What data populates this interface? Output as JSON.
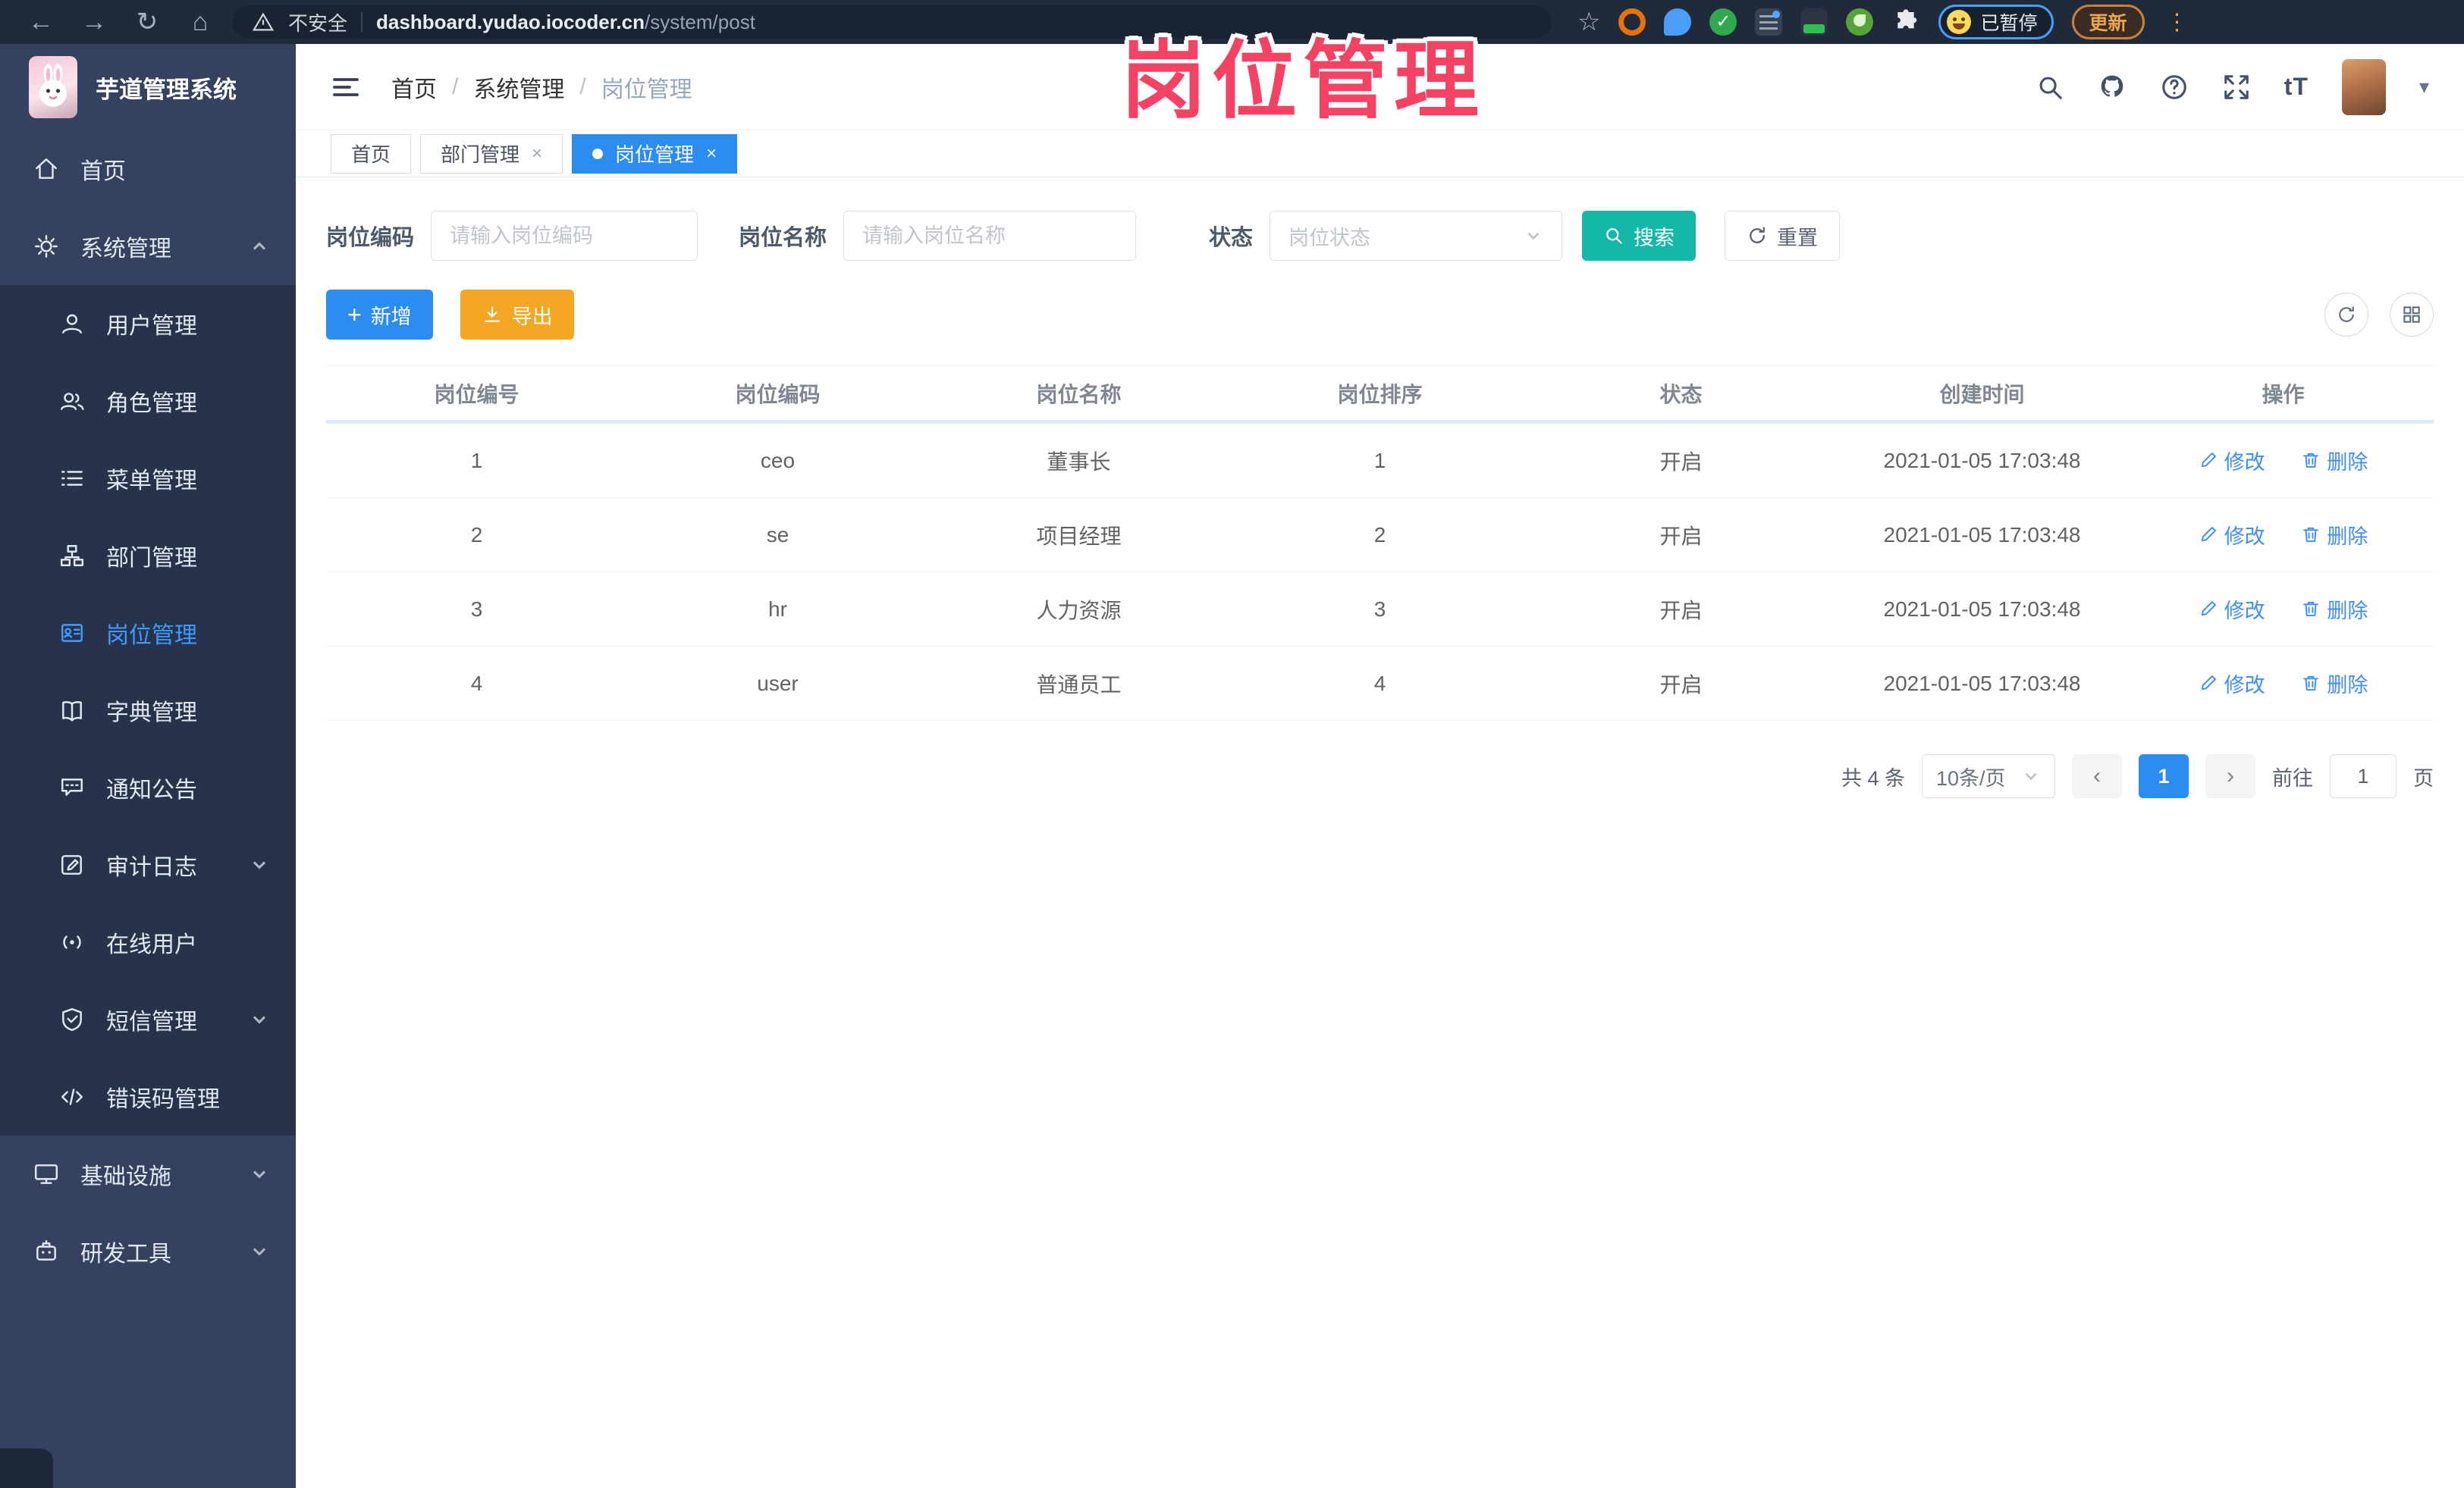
{
  "overlay": {
    "title": "岗位管理"
  },
  "browser": {
    "security_label": "不安全",
    "url_domain": "dashboard.yudao.iocoder.cn",
    "url_path": "/system/post",
    "paused_label": "已暂停",
    "update_label": "更新"
  },
  "colors": {
    "accent": "#2d8cf0",
    "teal": "#15b8a8",
    "warning": "#f5a623",
    "link": "#3e8ef7",
    "overlay_pink": "#f54263",
    "sidebar_bg": "#35425f",
    "submenu_bg": "#27334a"
  },
  "sidebar": {
    "logo_title": "芋道管理系统",
    "home_label": "首页",
    "system_label": "系统管理",
    "infra_label": "基础设施",
    "devtools_label": "研发工具",
    "submenu": [
      {
        "label": "用户管理"
      },
      {
        "label": "角色管理"
      },
      {
        "label": "菜单管理"
      },
      {
        "label": "部门管理"
      },
      {
        "label": "岗位管理"
      },
      {
        "label": "字典管理"
      },
      {
        "label": "通知公告"
      },
      {
        "label": "审计日志"
      },
      {
        "label": "在线用户"
      },
      {
        "label": "短信管理"
      },
      {
        "label": "错误码管理"
      }
    ]
  },
  "header": {
    "breadcrumb": [
      {
        "label": "首页"
      },
      {
        "label": "系统管理"
      },
      {
        "label": "岗位管理"
      }
    ],
    "font_icon_label": "tT"
  },
  "tabs": [
    {
      "label": "首页"
    },
    {
      "label": "部门管理"
    },
    {
      "label": "岗位管理"
    }
  ],
  "filters": {
    "code_label": "岗位编码",
    "code_placeholder": "请输入岗位编码",
    "name_label": "岗位名称",
    "name_placeholder": "请输入岗位名称",
    "status_label": "状态",
    "status_placeholder": "岗位状态",
    "search_label": "搜索",
    "reset_label": "重置"
  },
  "toolbar": {
    "add_label": "新增",
    "export_label": "导出"
  },
  "table": {
    "columns": [
      "岗位编号",
      "岗位编码",
      "岗位名称",
      "岗位排序",
      "状态",
      "创建时间",
      "操作"
    ],
    "rows": [
      {
        "id": "1",
        "code": "ceo",
        "name": "董事长",
        "sort": "1",
        "status": "开启",
        "created": "2021-01-05 17:03:48"
      },
      {
        "id": "2",
        "code": "se",
        "name": "项目经理",
        "sort": "2",
        "status": "开启",
        "created": "2021-01-05 17:03:48"
      },
      {
        "id": "3",
        "code": "hr",
        "name": "人力资源",
        "sort": "3",
        "status": "开启",
        "created": "2021-01-05 17:03:48"
      },
      {
        "id": "4",
        "code": "user",
        "name": "普通员工",
        "sort": "4",
        "status": "开启",
        "created": "2021-01-05 17:03:48"
      }
    ],
    "edit_label": "修改",
    "delete_label": "删除"
  },
  "pagination": {
    "total": "共 4 条",
    "page_size": "10条/页",
    "current_page": "1",
    "goto_label": "前往",
    "goto_value": "1",
    "page_unit": "页"
  }
}
